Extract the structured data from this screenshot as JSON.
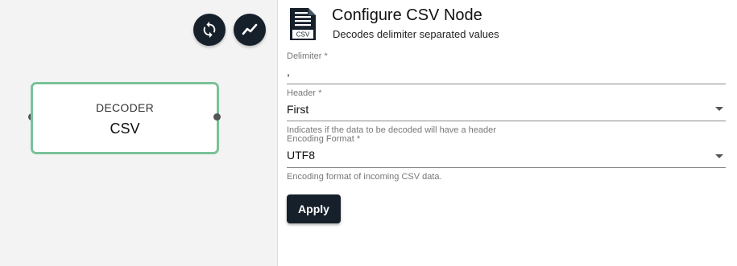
{
  "toolbar": {
    "refresh_icon": "refresh-icon",
    "chart_icon": "line-chart-icon"
  },
  "node": {
    "type": "DECODER",
    "name": "CSV",
    "border_color": "#7ac29a"
  },
  "panel": {
    "icon_label": "CSV",
    "title": "Configure CSV Node",
    "subtitle": "Decodes delimiter separated values",
    "fields": {
      "delimiter": {
        "label": "Delimiter *",
        "value": ","
      },
      "header": {
        "label": "Header *",
        "value": "First",
        "hint": "Indicates if the data to be decoded will have a header"
      },
      "encoding": {
        "label": "Encoding Format *",
        "value": "UTF8",
        "hint": "Encoding format of incoming CSV data."
      }
    },
    "apply_label": "Apply"
  },
  "colors": {
    "dark_button": "#16202b",
    "canvas_bg": "#f3f3f3"
  }
}
